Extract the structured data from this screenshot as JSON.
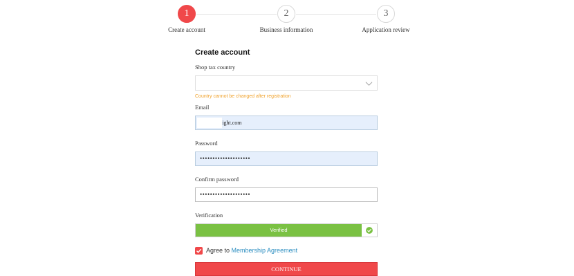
{
  "stepper": {
    "steps": [
      {
        "number": "1",
        "label": "Create account",
        "active": true
      },
      {
        "number": "2",
        "label": "Business information",
        "active": false
      },
      {
        "number": "3",
        "label": "Application review",
        "active": false
      }
    ]
  },
  "form": {
    "title": "Create account",
    "country": {
      "label": "Shop tax country",
      "value": "",
      "hint": "Country cannot be changed after registration"
    },
    "email": {
      "label": "Email",
      "value": "kaia@elfsight.com"
    },
    "password": {
      "label": "Password",
      "value": "••••••••••••••••••••"
    },
    "confirm_password": {
      "label": "Confirm password",
      "value": "••••••••••••••••••••"
    },
    "verification": {
      "label": "Verification",
      "status": "Verified"
    },
    "agree": {
      "prefix": "Agree to ",
      "link": "Membership Agreement",
      "checked": true
    },
    "continue_label": "CONTINUE"
  },
  "colors": {
    "accent": "#f0484a",
    "verified": "#7ac143",
    "hint": "#f0a12a",
    "link": "#2a8dc0"
  }
}
